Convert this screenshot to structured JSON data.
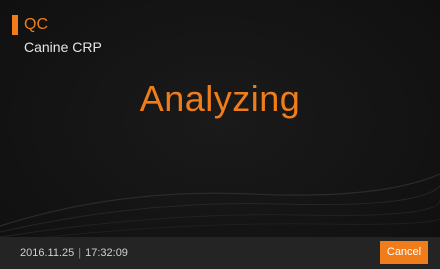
{
  "header": {
    "mode_title": "QC",
    "test_name": "Canine CRP"
  },
  "main": {
    "status": "Analyzing"
  },
  "footer": {
    "date": "2016.11.25",
    "separator": "|",
    "time": "17:32:09",
    "cancel_label": "Cancel"
  },
  "colors": {
    "accent": "#f07d1a",
    "background": "#141414",
    "footer_bg": "#242424",
    "secondary_text": "#e6e6e6"
  }
}
